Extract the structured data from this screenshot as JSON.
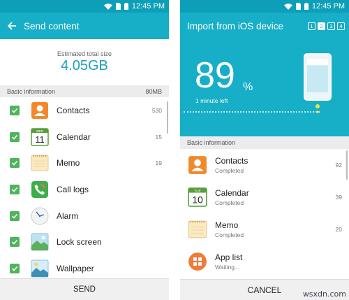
{
  "status_bar": {
    "time": "12:45 PM"
  },
  "left_screen": {
    "title": "Send content",
    "estimated_label": "Estimated total size",
    "estimated_value": "4.05GB",
    "section": {
      "label": "Basic information",
      "size": "80MB"
    },
    "items": [
      {
        "label": "Contacts",
        "count": "530",
        "icon": "contacts-icon"
      },
      {
        "label": "Calendar",
        "count": "15",
        "icon": "calendar-icon"
      },
      {
        "label": "Memo",
        "count": "19",
        "icon": "memo-icon"
      },
      {
        "label": "Call logs",
        "count": "",
        "icon": "phone-icon"
      },
      {
        "label": "Alarm",
        "count": "",
        "icon": "clock-icon"
      },
      {
        "label": "Lock screen",
        "count": "",
        "icon": "lock-screen-icon"
      },
      {
        "label": "Wallpaper",
        "count": "",
        "icon": "wallpaper-icon"
      }
    ],
    "send_label": "SEND"
  },
  "right_screen": {
    "title": "Import from iOS device",
    "steps": [
      "1",
      "2",
      "3",
      "4"
    ],
    "progress": {
      "value": "89",
      "unit": "%",
      "fraction": 0.89
    },
    "time_left": "1 minute left",
    "section": "Basic information",
    "items": [
      {
        "title": "Contacts",
        "status": "Completed",
        "count": "92",
        "icon": "contacts-icon"
      },
      {
        "title": "Calendar",
        "status": "Completed",
        "count": "39",
        "icon": "calendar-icon"
      },
      {
        "title": "Memo",
        "status": "Completed",
        "count": "20",
        "icon": "memo-icon"
      },
      {
        "title": "App list",
        "status": "Waiting...",
        "count": "",
        "icon": "app-list-icon"
      }
    ],
    "cancel_label": "CANCEL"
  },
  "calendar_icon": {
    "month": "WED",
    "day": "11"
  },
  "calendar_icon_right": {
    "month": "TUE",
    "day": "10"
  },
  "watermark": "wsxdn.com",
  "colors": {
    "accent": "#17aec7",
    "status_bar": "#0d9fb8",
    "checkbox": "#4fb45b",
    "value_text": "#1a9fbd"
  }
}
